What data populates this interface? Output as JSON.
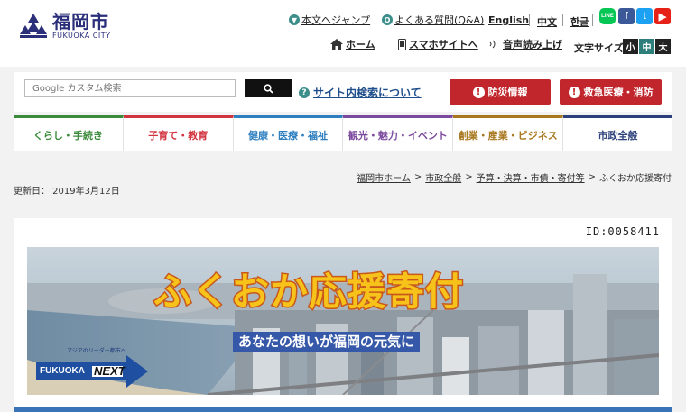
{
  "header": {
    "logo_main": "福岡市",
    "logo_sub": "FUKUOKA CITY",
    "skip_link": "本文へジャンプ",
    "faq_link": "よくある質問(Q&A)",
    "languages": [
      "English",
      "中文",
      "한글"
    ],
    "home_link": "ホーム",
    "smartphone_link": "スマホサイトへ",
    "read_aloud_link": "音声読み上げ",
    "font_size_label": "文字サイズ",
    "font_sizes": [
      "小",
      "中",
      "大"
    ],
    "sns": [
      "LINE",
      "f",
      "t",
      "▶"
    ]
  },
  "search": {
    "placeholder": "Google カスタム検索",
    "help_link": "サイト内検索について"
  },
  "emergency": {
    "disaster": "防災情報",
    "medical": "救急医療・消防"
  },
  "nav": {
    "items": [
      {
        "label": "くらし・手続き",
        "color": "#3b8a3a"
      },
      {
        "label": "子育て・教育",
        "color": "#d1333f"
      },
      {
        "label": "健康・医療・福祉",
        "color": "#2e7fc0"
      },
      {
        "label": "観光・魅力・イベント",
        "color": "#7b4a9e"
      },
      {
        "label": "創業・産業・ビジネス",
        "color": "#a8781f"
      },
      {
        "label": "市政全般",
        "color": "#2b3f7a"
      }
    ]
  },
  "breadcrumb": [
    "福岡市ホーム",
    "市政全般",
    "予算・決算・市債・寄付等",
    "ふくおか応援寄付"
  ],
  "updated": "更新日：  2019年3月12日",
  "page_id": "ID:0058411",
  "banner": {
    "title": "ふくおか応援寄付",
    "subtitle": "あなたの想いが福岡の元気に",
    "badge_top": "アジアのリーダー都市へ",
    "badge_left": "FUKUOKA",
    "badge_right": "NEXT"
  }
}
